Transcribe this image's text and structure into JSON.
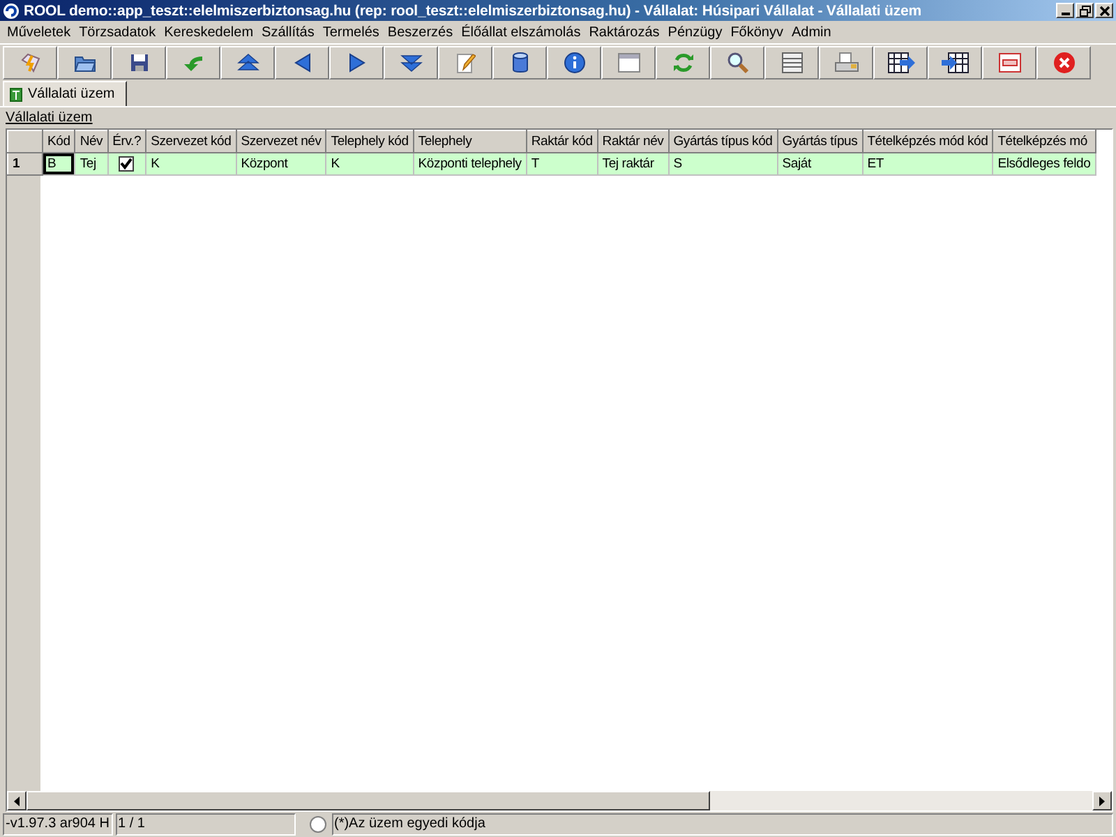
{
  "window": {
    "title": "ROOL demo::app_teszt::elelmiszerbiztonsag.hu (rep: rool_teszt::elelmiszerbiztonsag.hu) - Vállalat: Húsipari Vállalat - Vállalati üzem"
  },
  "menu": [
    "Műveletek",
    "Törzsadatok",
    "Kereskedelem",
    "Szállítás",
    "Termelés",
    "Beszerzés",
    "Élőállat elszámolás",
    "Raktározás",
    "Pénzügy",
    "Főkönyv",
    "Admin"
  ],
  "tabs": [
    {
      "label": "Vállalati üzem",
      "selected": true
    }
  ],
  "section_link": "Vállalati üzem",
  "table": {
    "columns": [
      "Kód",
      "Név",
      "Érv.?",
      "Szervezet kód",
      "Szervezet név",
      "Telephely kód",
      "Telephely",
      "Raktár kód",
      "Raktár név",
      "Gyártás típus kód",
      "Gyártás típus",
      "Tételképzés mód kód",
      "Tételképzés mó"
    ],
    "rows": [
      {
        "number": "1",
        "selected": true,
        "cells": [
          {
            "kind": "text",
            "text": "B",
            "focused": true
          },
          {
            "kind": "text",
            "text": "Tej",
            "focused": false
          },
          {
            "kind": "check",
            "checked": true,
            "focused": false
          },
          {
            "kind": "text",
            "text": "K",
            "focused": false
          },
          {
            "kind": "text",
            "text": "Központ",
            "focused": false
          },
          {
            "kind": "text",
            "text": "K",
            "focused": false
          },
          {
            "kind": "text",
            "text": "Központi telephely",
            "focused": false
          },
          {
            "kind": "text",
            "text": "T",
            "focused": false
          },
          {
            "kind": "text",
            "text": "Tej raktár",
            "focused": false
          },
          {
            "kind": "text",
            "text": "S",
            "focused": false
          },
          {
            "kind": "text",
            "text": "Saját",
            "focused": false
          },
          {
            "kind": "text",
            "text": "ET",
            "focused": false
          },
          {
            "kind": "text",
            "text": "Elsődleges feldo",
            "focused": false
          }
        ]
      }
    ]
  },
  "status_bar": {
    "version": "-v1.97.3 ar904 H",
    "record": "1 / 1",
    "radio": {
      "selected": false
    },
    "hint": "(*)Az üzem egyedi kódja"
  }
}
